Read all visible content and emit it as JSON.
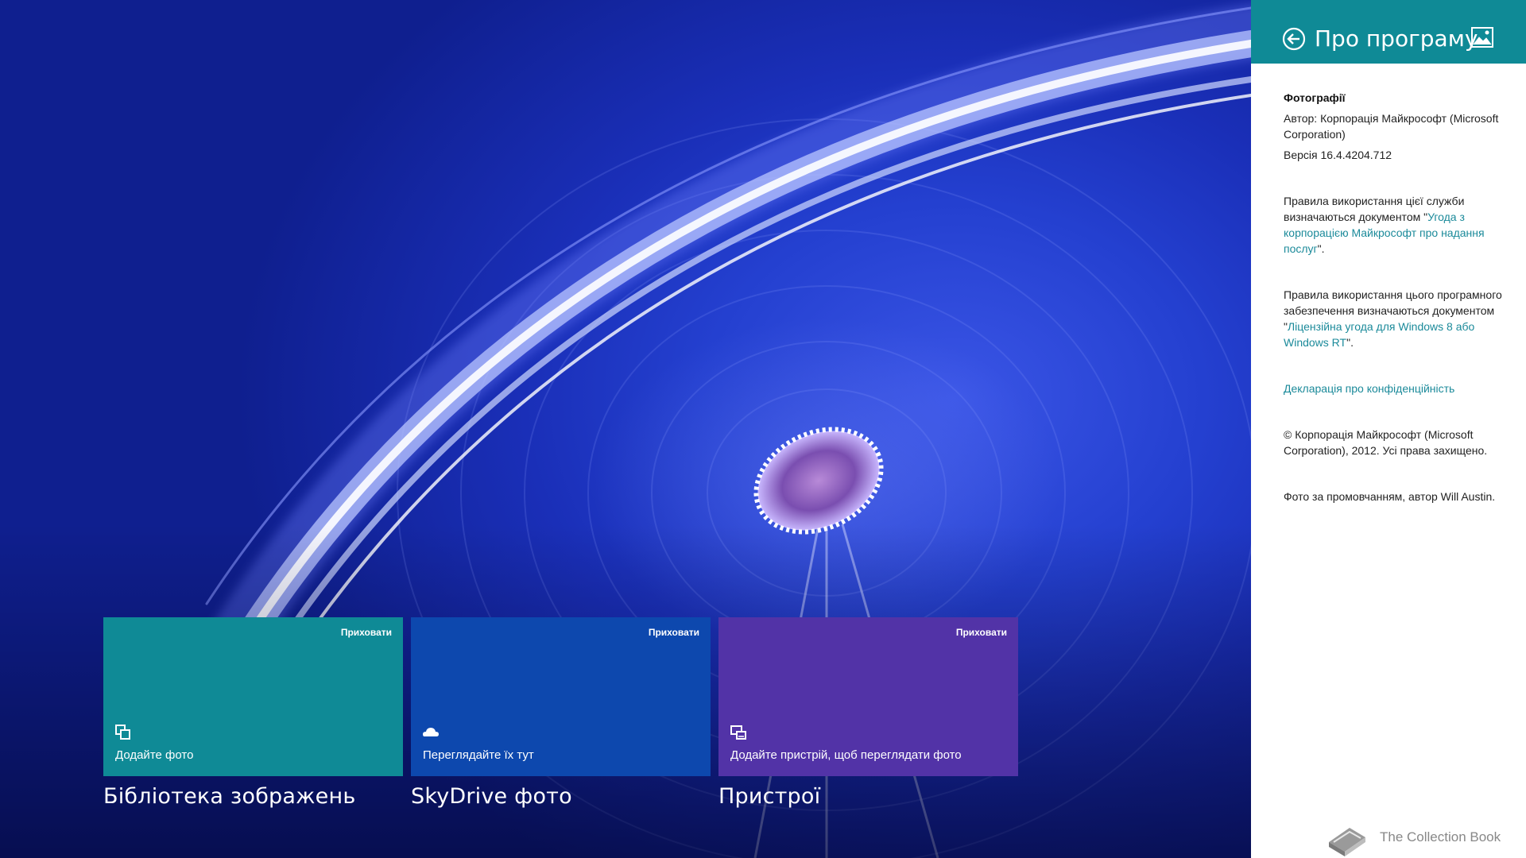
{
  "tiles": [
    {
      "hide_label": "Приховати",
      "description": "Додайте фото",
      "title": "Бібліотека зображень",
      "color": "#0f8a96",
      "icon": "pictures-library-icon"
    },
    {
      "hide_label": "Приховати",
      "description": "Переглядайте їх тут",
      "title": "SkyDrive фото",
      "color": "#0d48ae",
      "icon": "skydrive-cloud-icon"
    },
    {
      "hide_label": "Приховати",
      "description": "Додайте пристрій, щоб переглядати фото",
      "title": "Пристрої",
      "color": "#5233a7",
      "icon": "devices-icon"
    }
  ],
  "pane": {
    "title": "Про програму",
    "header_color": "#0f8a96",
    "app_name": "Фотографії",
    "author": "Автор: Корпорація Майкрософт (Microsoft Corporation)",
    "version": "Версія 16.4.4204.712",
    "terms1_pre": "Правила використання цієї служби визначаються документом \"",
    "terms1_link": "Угода з корпорацією Майкрософт про надання послуг",
    "terms1_post": "\".",
    "terms2_pre": "Правила використання цього програмного забезпечення визначаються документом \"",
    "terms2_link": "Ліцензійна угода для Windows 8 або Windows RT",
    "terms2_post": "\".",
    "privacy_link": "Декларація про конфіденційність",
    "copyright": "© Корпорація Майкрософт (Microsoft Corporation), 2012. Усі права захищено.",
    "photo_credit": "Фото за промовчанням, автор Will Austin.",
    "link_color": "#1b8a9a"
  },
  "watermark": {
    "text": "The Collection Book",
    "icon": "book-icon"
  }
}
